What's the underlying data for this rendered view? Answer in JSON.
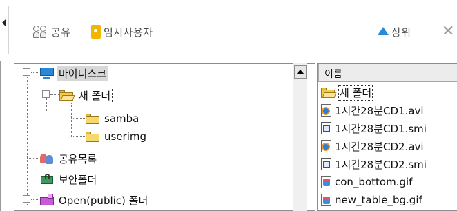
{
  "toolbar": {
    "share_label": "공유",
    "guest_label": "임시사용자",
    "up_label": "상위",
    "close_symbol": "✕"
  },
  "tree": {
    "items": [
      {
        "label": "마이디스크",
        "icon": "computer-icon",
        "selected": true
      },
      {
        "label": "새 폴더",
        "icon": "folder-open-icon",
        "focused": true
      },
      {
        "label": "samba",
        "icon": "folder-icon"
      },
      {
        "label": "userimg",
        "icon": "folder-icon"
      },
      {
        "label": "공유목록",
        "icon": "share-users-icon"
      },
      {
        "label": "보안폴더",
        "icon": "secure-folder-icon"
      },
      {
        "label": "Open(public) 폴더",
        "icon": "public-folder-icon"
      }
    ]
  },
  "list": {
    "column_header": "이름",
    "items": [
      {
        "name": "새 폴더",
        "icon": "folder-open-icon",
        "focused": true
      },
      {
        "name": "1시간28분CD1.avi",
        "icon": "video-file-icon"
      },
      {
        "name": "1시간28분CD1.smi",
        "icon": "subtitle-file-icon"
      },
      {
        "name": "1시간28분CD2.avi",
        "icon": "video-file-icon"
      },
      {
        "name": "1시간28분CD2.smi",
        "icon": "subtitle-file-icon"
      },
      {
        "name": "con_bottom.gif",
        "icon": "image-file-icon"
      },
      {
        "name": "new_table_bg.gif",
        "icon": "image-file-icon"
      }
    ]
  },
  "colors": {
    "selection": "#d8d8d8",
    "accent_blue": "#2b8ad6",
    "guest_yellow": "#f2b600"
  }
}
